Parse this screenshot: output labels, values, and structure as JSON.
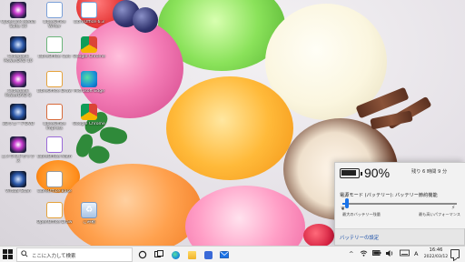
{
  "desktop": {
    "icons": [
      {
        "label": "CyberLink Media Suite 10",
        "glyph": "",
        "style": "g-cyber"
      },
      {
        "label": "CyberLink PowerDVD 10",
        "glyph": "",
        "style": "g-cyberdark"
      },
      {
        "label": "CyberLink PowerDVD 8",
        "glyph": "",
        "style": "g-cyber"
      },
      {
        "label": "3DヴューアDVD",
        "glyph": "",
        "style": "g-cyberdark"
      },
      {
        "label": "エメラルドボックス",
        "glyph": "",
        "style": "g-cyber"
      },
      {
        "label": "Virtual Scan",
        "glyph": "",
        "style": "g-cyberdark"
      },
      {
        "label": "LibreOffice Writer",
        "glyph": "W",
        "style": "g-doc"
      },
      {
        "label": "LibreOffice Calc",
        "glyph": "C",
        "style": "g-calc"
      },
      {
        "label": "LibreOffice Draw",
        "glyph": "D",
        "style": "g-draw"
      },
      {
        "label": "LibreOffice Impress",
        "glyph": "I",
        "style": "g-impress"
      },
      {
        "label": "LibreOffice Math",
        "glyph": "M",
        "style": "g-math"
      },
      {
        "label": "LibreOffice Base",
        "glyph": "B",
        "style": "g-base"
      },
      {
        "label": "OpenOffice Draw",
        "glyph": "D",
        "style": "g-draw"
      },
      {
        "label": "LibreOffice 6.3",
        "glyph": "L",
        "style": "g-doc"
      },
      {
        "label": "Google Chrome",
        "glyph": "",
        "style": "g-chrome"
      },
      {
        "label": "Microsoft Edge",
        "glyph": "",
        "style": "g-edge"
      },
      {
        "label": "Google Chrome",
        "glyph": "",
        "style": "g-chrome"
      },
      {
        "label": "ごみ箱",
        "glyph": "♻",
        "style": "g-recycle"
      }
    ]
  },
  "battery_flyout": {
    "percent_text": "90%",
    "percent_value": 0.9,
    "remaining": "残り 6 時間 9 分",
    "mode_label": "電源モード (バッテリー): バッテリー節約機能",
    "slider_position": 0.02,
    "left_caption": "最大のバッテリー残量",
    "right_caption": "最も高いパフォーマンス",
    "settings_link": "バッテリーの設定",
    "leaf_icon": "leaf-icon",
    "bolt_icon": "bolt-icon"
  },
  "taskbar": {
    "search_placeholder": "ここに入力して検索",
    "apps": [
      {
        "name": "search-circle-icon",
        "color": "#ffffff"
      },
      {
        "name": "task-view-icon",
        "color": "#ffffff"
      },
      {
        "name": "edge-icon",
        "color": "#1a8fd8"
      },
      {
        "name": "explorer-icon",
        "color": "#f4c430"
      },
      {
        "name": "store-icon",
        "color": "#3a6ad8"
      },
      {
        "name": "mail-icon",
        "color": "#1a73e8"
      }
    ],
    "tray": {
      "chevron": "^",
      "battery_glyph": "🔋",
      "ime": "A"
    },
    "clock_time": "16:46",
    "clock_date": "2022/03/12"
  },
  "colors": {
    "accent": "#1a73e8",
    "taskbar_bg": "#f3f3f3",
    "flyout_bg": "#f2f2f2"
  }
}
